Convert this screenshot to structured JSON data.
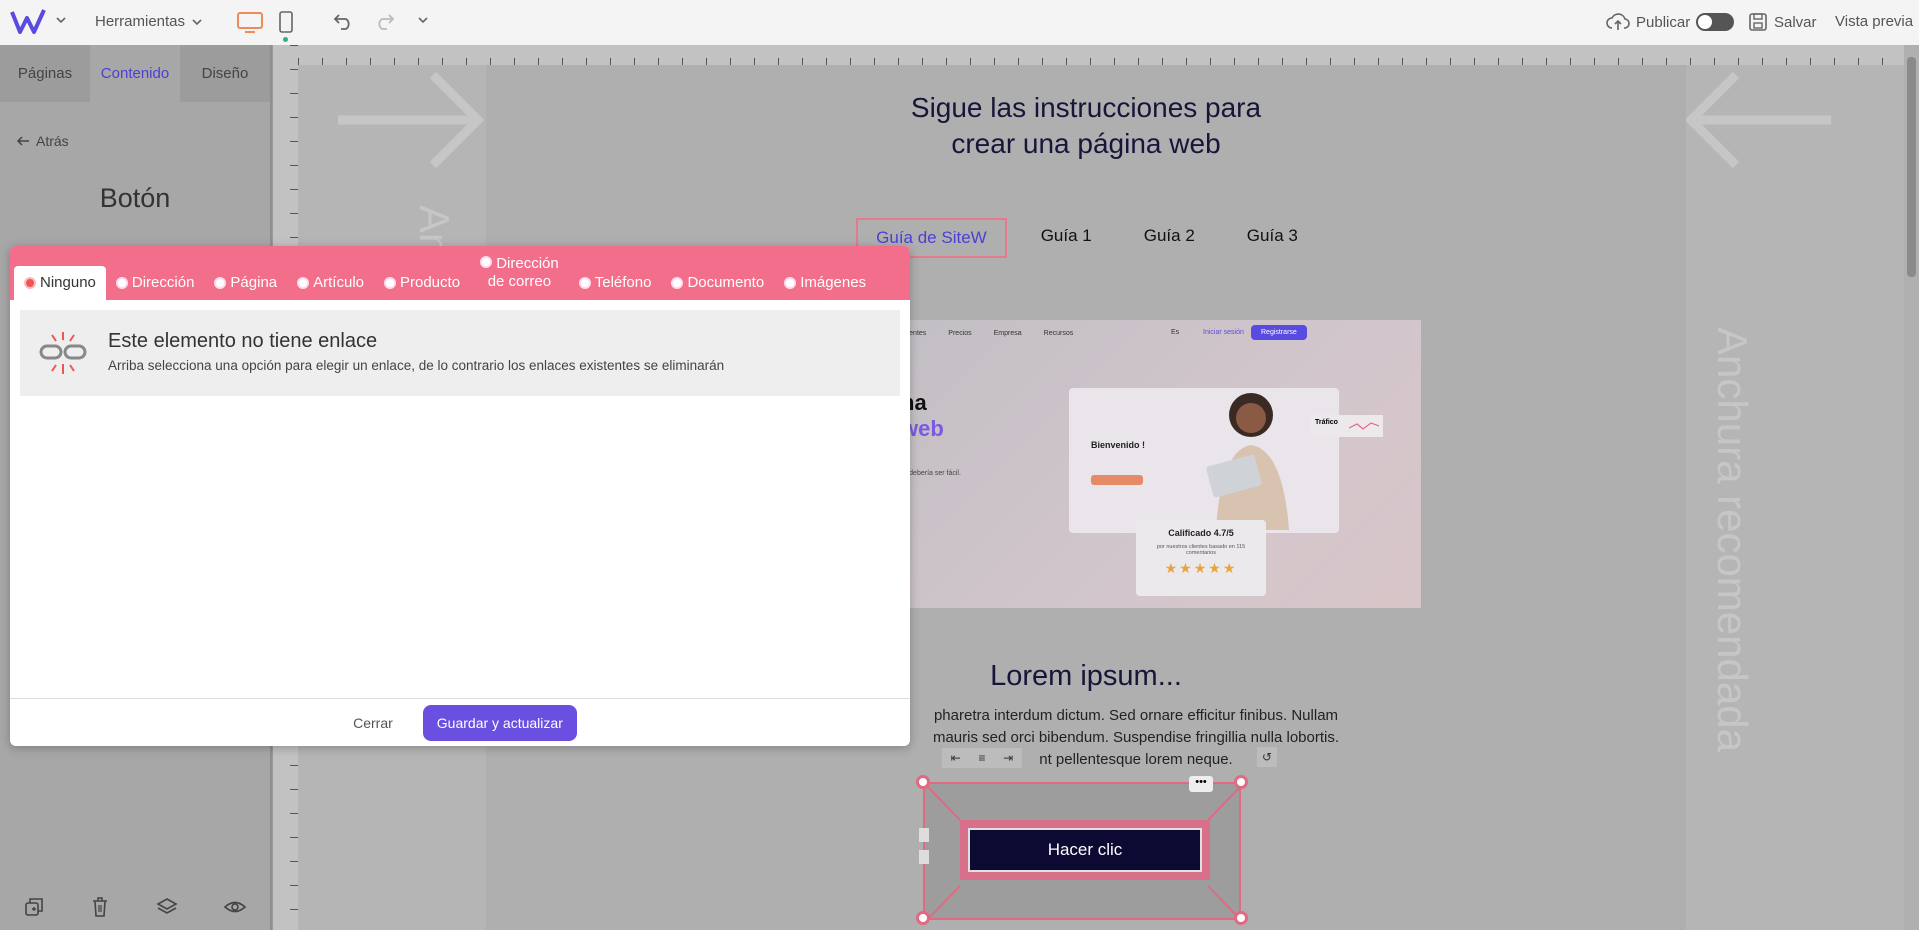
{
  "topbar": {
    "tools_label": "Herramientas",
    "publish_label": "Publicar",
    "save_label": "Salvar",
    "preview_label": "Vista previa"
  },
  "sidebar": {
    "tabs": [
      {
        "label": "Páginas"
      },
      {
        "label": "Contenido"
      },
      {
        "label": "Diseño"
      }
    ],
    "back_label": "Atrás",
    "title": "Botón"
  },
  "canvas": {
    "vertical_label": "Anchura recomendada",
    "headline_line1": "Sigue las instrucciones para",
    "headline_line2": "crear una página web",
    "nav": [
      {
        "label": "Guía de SiteW"
      },
      {
        "label": "Guía 1"
      },
      {
        "label": "Guía 2"
      },
      {
        "label": "Guía 3"
      }
    ],
    "hero": {
      "nav_items": [
        "Clientes",
        "Precios",
        "Empresa",
        "Recursos"
      ],
      "lang": "Es",
      "login": "Iniciar sesión",
      "register": "Registrarse",
      "welcome": "Bienvenido !",
      "traffic": "Tráfico",
      "rating": "Calificado 4.7/5",
      "rating_sub": "por nuestros clientes basado en 115 comentarios",
      "word1": "na",
      "word2": "web",
      "small_text": "re debería ser fácil."
    },
    "lorem_title": "Lorem ipsum...",
    "lorem_lines": [
      "pharetra interdum dictum. Sed ornare efficitur finibus. Nullam",
      "mauris sed orci bibendum. Suspendise fringillia nulla lobortis.",
      "nt pellentesque lorem neque."
    ],
    "button_label": "Hacer clic"
  },
  "modal": {
    "tabs": [
      {
        "label": "Ninguno"
      },
      {
        "label": "Dirección"
      },
      {
        "label": "Página"
      },
      {
        "label": "Artículo"
      },
      {
        "label": "Producto"
      },
      {
        "label": "Dirección",
        "label2": "de correo"
      },
      {
        "label": "Teléfono"
      },
      {
        "label": "Documento"
      },
      {
        "label": "Imágenes"
      }
    ],
    "notice_title": "Este elemento no tiene enlace",
    "notice_desc": "Arriba selecciona una opción para elegir un enlace, de lo contrario los enlaces existentes se eliminarán",
    "close_label": "Cerrar",
    "save_label": "Guardar y actualizar"
  },
  "colors": {
    "accent": "#6a4fe0",
    "modal_header": "#f26e8a",
    "selection": "#e06a82",
    "desktop_icon": "#f08a5d"
  }
}
